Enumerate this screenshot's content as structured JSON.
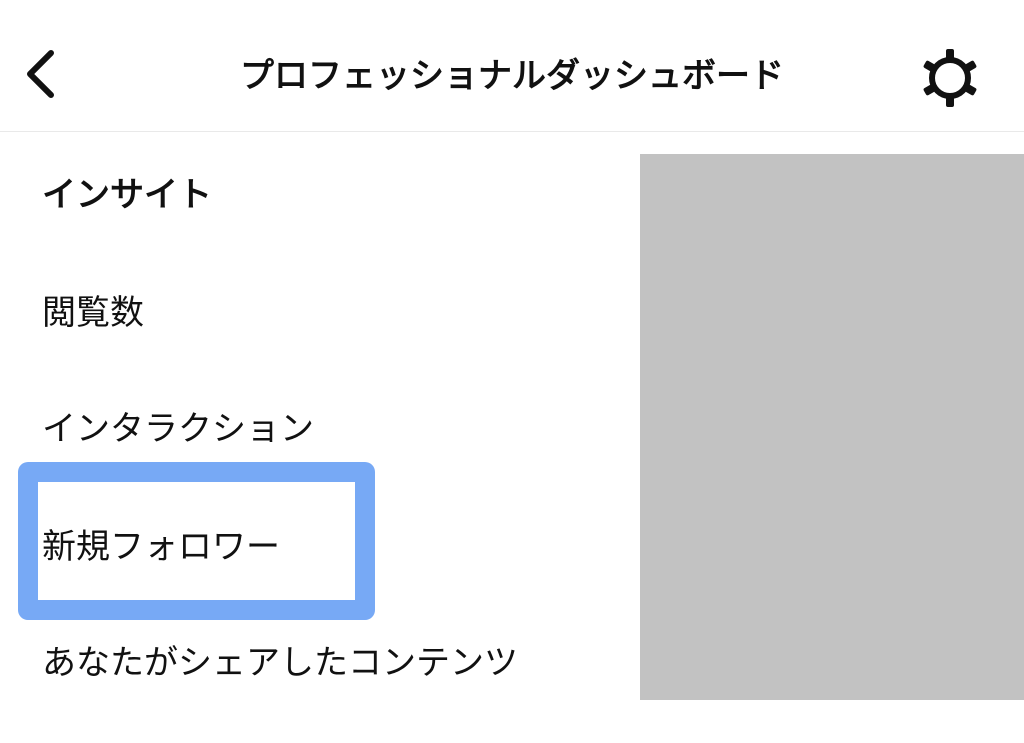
{
  "header": {
    "title": "プロフェッショナルダッシュボード",
    "back_icon": "chevron-left-icon",
    "settings_icon": "gear-icon"
  },
  "insights": {
    "heading": "インサイト",
    "items": [
      {
        "label": "閲覧数"
      },
      {
        "label": "インタラクション"
      },
      {
        "label": "新規フォロワー",
        "highlighted": true
      },
      {
        "label": "あなたがシェアしたコンテンツ"
      }
    ]
  },
  "colors": {
    "highlight": "#77a9f5",
    "panel": "#c2c2c2",
    "text": "#111111"
  }
}
